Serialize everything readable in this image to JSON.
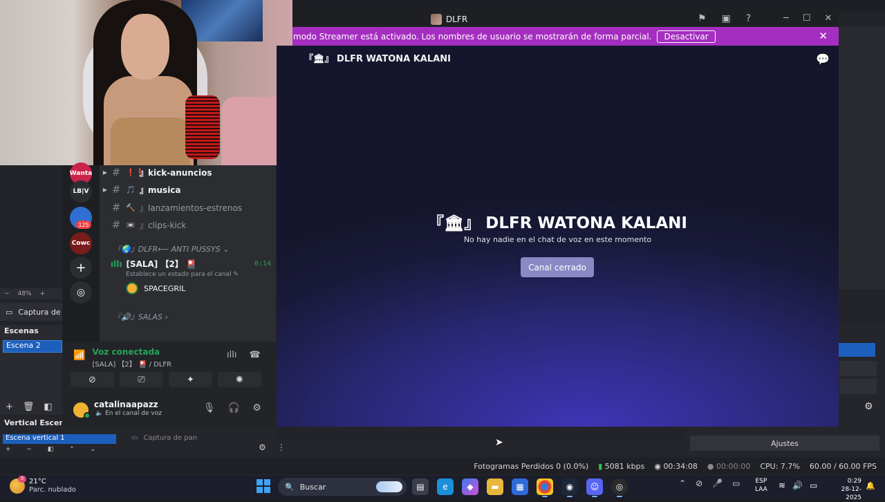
{
  "discord": {
    "window_title": "DLFR",
    "title_icons": [
      "flag-icon",
      "inbox-icon",
      "help-icon"
    ],
    "window_controls": [
      "─",
      "☐",
      "✕"
    ],
    "banner": {
      "message": "modo Streamer está activado. Los nombres de usuario se mostrarán de forma parcial.",
      "button": "Desactivar",
      "close": "✕"
    },
    "stage": {
      "header": "『🏛』 DLFR WATONA KALANI",
      "title": "『🏛』 DLFR WATONA KALANI",
      "subtitle": "No hay nadie en el chat de voz en este momento",
      "button": "Canal cerrado"
    },
    "servers": [
      {
        "label": "Wanta",
        "color": "#c9234a"
      },
      {
        "label": "LB|V",
        "color": "#2b2d31"
      },
      {
        "label": "",
        "color": "#2f6fd1",
        "badge": "125"
      },
      {
        "label": "Cowc",
        "color": "#7a1c1c"
      }
    ],
    "server_actions": [
      "+",
      "◎"
    ],
    "channels": [
      {
        "emoji": "❗❗",
        "name": "』kick-anuncios",
        "style": "bright",
        "arrow": "▶"
      },
      {
        "emoji": "🎵",
        "name": "』musica",
        "style": "bright",
        "arrow": "▶"
      },
      {
        "emoji": "🔨",
        "name": "』lanzamientos-estrenos",
        "style": "dim",
        "arrow": ""
      },
      {
        "emoji": "📼",
        "name": "』clips-kick",
        "style": "dim",
        "arrow": ""
      }
    ],
    "category_1": "『🌏』DLFR⟵ ANTI PUSSYS ⌄",
    "voice_channel": {
      "name": "[SALA] 【2】 🎴",
      "time": "0:14",
      "status": "Establece un estado para el canal ✎",
      "user": "SPACEGRIL"
    },
    "category_2": "『🔊』SALAS ›",
    "voice_panel": {
      "title": "Voz conectada",
      "subtitle": "[SALA] 【2】 🎴 / DLFR"
    },
    "voice_actions": [
      "⊘",
      "⎚",
      "✦",
      "✺"
    ],
    "user": {
      "name": "catalinaapazz",
      "status": "🔈 En el canal de voz"
    }
  },
  "obs": {
    "zoom": "48%",
    "capture_label": "Captura de",
    "scenes_header": "Escenas",
    "scene_item": "Escena 2",
    "scene_tools": [
      "+",
      "🗑",
      "◧"
    ],
    "vertical_header": "Vertical Escena",
    "vertical_item": "Escena vertical 1",
    "vertical_source": "Captura de pan",
    "ajustes": "Ajustes",
    "status": {
      "frames": "Fotogramas Perdidos 0 (0.0%)",
      "kbps": "5081 kbps",
      "stream_time": "00:34:08",
      "rec_time": "00:00:00",
      "cpu": "CPU: 7.7%",
      "fps": "60.00 / 60.00 FPS"
    }
  },
  "taskbar": {
    "weather_temp": "21°C",
    "weather_desc": "Parc. nublado",
    "weather_badge": "3",
    "search_placeholder": "Buscar",
    "lang_1": "ESP",
    "lang_2": "LAA",
    "time": "0:29",
    "date": "28-12-2025"
  }
}
